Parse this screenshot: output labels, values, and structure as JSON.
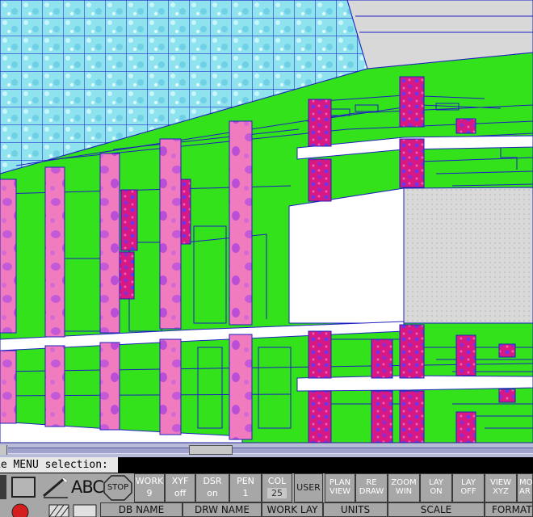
{
  "command_prompt": "ke MENU selection:",
  "status_fields": [
    {
      "label": "WORK",
      "value": "9"
    },
    {
      "label": "XYF",
      "value": "off"
    },
    {
      "label": "DSR",
      "value": "on"
    },
    {
      "label": "PEN",
      "value": "1"
    },
    {
      "label": "COL",
      "value": "25"
    }
  ],
  "stop_button": "STOP",
  "user_button": "USER",
  "command_buttons": [
    {
      "line1": "PLAN",
      "line2": "VIEW"
    },
    {
      "line1": "RE",
      "line2": "DRAW"
    },
    {
      "line1": "ZOOM",
      "line2": "WIN"
    },
    {
      "line1": "LAY",
      "line2": "ON"
    },
    {
      "line1": "LAY",
      "line2": "OFF"
    },
    {
      "line1": "VIEW",
      "line2": "XYZ"
    },
    {
      "line1": "MO",
      "line2": "AR"
    }
  ],
  "bottom_labels": [
    "DB NAME",
    "DRW NAME",
    "WORK LAY",
    "UNITS",
    "SCALE",
    "FORMAT"
  ],
  "text_tool_label": "ABC",
  "colors": {
    "floor_green": "#34e21c",
    "column_pink": "#f07bbf",
    "column_magenta": "#d9147f",
    "wall_white": "#ffffff",
    "roof_cyan": "#8fe7f0",
    "grid_blue": "#2222cc",
    "toolbar_gray": "#a7a7a7"
  }
}
